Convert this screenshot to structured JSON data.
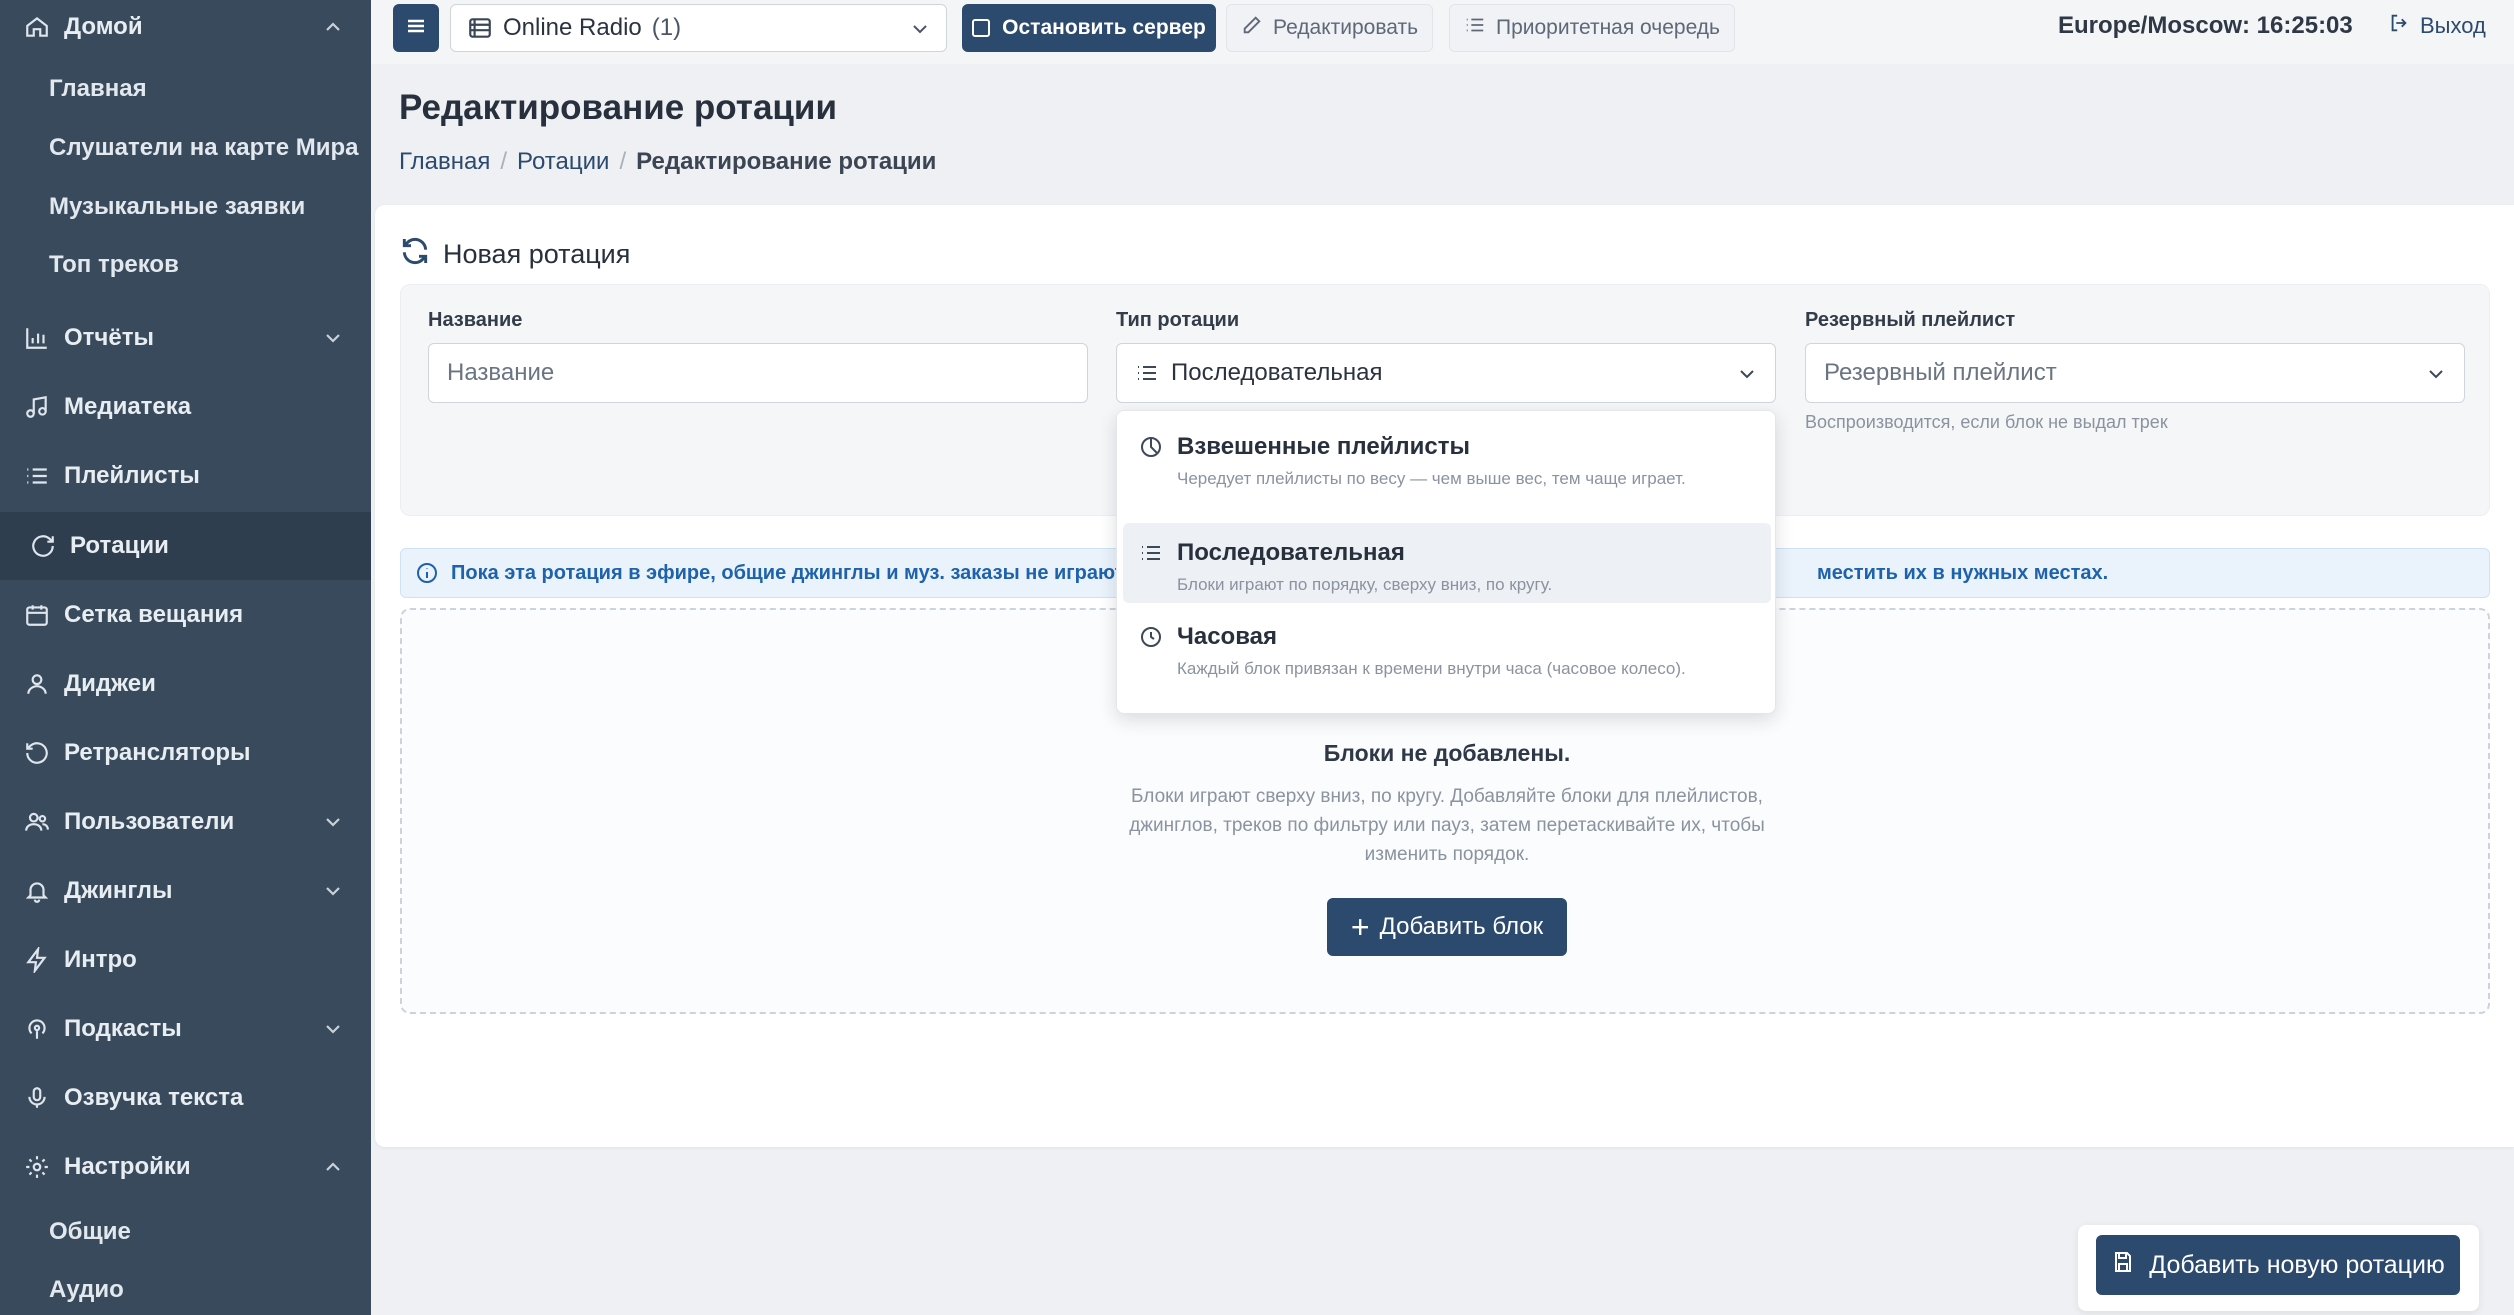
{
  "sidebar": {
    "items": [
      {
        "label": "Домой",
        "icon": "home-icon",
        "chevron": "up"
      },
      {
        "label": "Главная"
      },
      {
        "label": "Слушатели на карте Мира"
      },
      {
        "label": "Музыкальные заявки"
      },
      {
        "label": "Топ треков"
      },
      {
        "label": "Отчёты",
        "icon": "bar-chart-icon",
        "chevron": "down"
      },
      {
        "label": "Медиатека",
        "icon": "music-note-icon"
      },
      {
        "label": "Плейлисты",
        "icon": "list-icon"
      },
      {
        "label": "Ротации",
        "icon": "rotate-icon",
        "active": true
      },
      {
        "label": "Сетка вещания",
        "icon": "calendar-icon"
      },
      {
        "label": "Диджеи",
        "icon": "user-icon"
      },
      {
        "label": "Ретрансляторы",
        "icon": "history-icon"
      },
      {
        "label": "Пользователи",
        "icon": "users-icon",
        "chevron": "down"
      },
      {
        "label": "Джинглы",
        "icon": "bell-icon",
        "chevron": "down"
      },
      {
        "label": "Интро",
        "icon": "lightning-icon"
      },
      {
        "label": "Подкасты",
        "icon": "podcast-icon",
        "chevron": "down"
      },
      {
        "label": "Озвучка текста",
        "icon": "microphone-icon"
      },
      {
        "label": "Настройки",
        "icon": "gear-icon",
        "chevron": "up"
      },
      {
        "label": "Общие"
      },
      {
        "label": "Аудио"
      }
    ]
  },
  "topbar": {
    "station_name": "Online Radio",
    "station_count": "(1)",
    "stop_label": "Остановить сервер",
    "edit_label": "Редактировать",
    "queue_label": "Приоритетная очередь",
    "clock": "Europe/Moscow: 16:25:03",
    "logout_label": "Выход"
  },
  "page": {
    "title": "Редактирование ротации",
    "breadcrumb": [
      "Главная",
      "Ротации",
      "Редактирование ротации"
    ]
  },
  "form": {
    "card_title": "Новая ротация",
    "name_label": "Название",
    "name_placeholder": "Название",
    "type_label": "Тип ротации",
    "type_value": "Последовательная",
    "fallback_label": "Резервный плейлист",
    "fallback_placeholder": "Резервный плейлист",
    "fallback_help": "Воспроизводится, если блок не выдал трек"
  },
  "dropdown": {
    "options": [
      {
        "title": "Взвешенные плейлисты",
        "desc": "Чередует плейлисты по весу — чем выше вес, тем чаще играет.",
        "icon": "pie-chart-icon"
      },
      {
        "title": "Последовательная",
        "desc": "Блоки играют по порядку, сверху вниз, по кругу.",
        "icon": "list-icon",
        "active": true
      },
      {
        "title": "Часовая",
        "desc": "Каждый блок привязан к времени внутри часа (часовое колесо).",
        "icon": "clock-icon"
      }
    ]
  },
  "alert": {
    "text_start": "Пока эта ротация в эфире, общие джинглы и муз. заказы не играют",
    "text_end": "местить их в нужных местах."
  },
  "empty": {
    "title": "Блоки не добавлены.",
    "desc": "Блоки играют сверху вниз, по кругу. Добавляйте блоки для плейлистов, джинглов, треков по фильтру или пауз, затем перетаскивайте их, чтобы изменить порядок.",
    "add_label": "Добавить блок"
  },
  "save_label": "Добавить новую ротацию",
  "colors": {
    "sidebar_bg": "#384a5c",
    "sidebar_active": "#2e3e4e",
    "accent": "#2c4a6e",
    "alert_text": "#1e62ad"
  }
}
